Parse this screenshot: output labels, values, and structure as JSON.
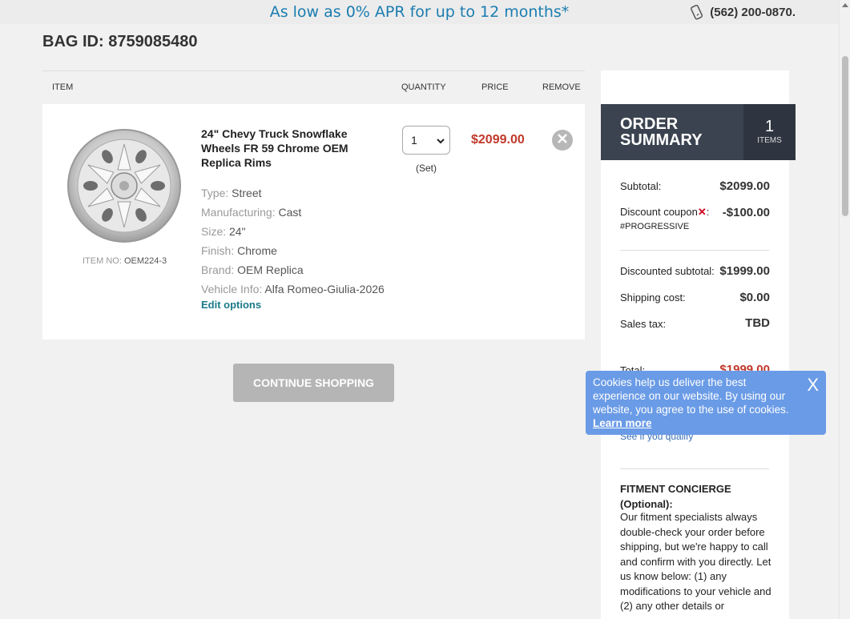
{
  "promo_text": "As low as 0% APR for up to 12 months*",
  "phone": "(562) 200-0870.",
  "bag_id": "BAG ID: 8759085480",
  "cart_headers": {
    "item": "ITEM",
    "quantity": "QUANTITY",
    "price": "PRICE",
    "remove": "REMOVE"
  },
  "item": {
    "title": "24\" Chevy Truck Snowflake Wheels FR 59 Chrome OEM Replica Rims",
    "item_no_label": "ITEM NO:",
    "item_no": "OEM224-3",
    "attributes": [
      {
        "key": "Type:",
        "value": "Street"
      },
      {
        "key": "Manufacturing:",
        "value": "Cast"
      },
      {
        "key": "Size:",
        "value": "24\""
      },
      {
        "key": "Finish:",
        "value": "Chrome"
      },
      {
        "key": "Brand:",
        "value": "OEM Replica"
      },
      {
        "key": "Vehicle Info:",
        "value": "Alfa Romeo-Giulia-2026"
      }
    ],
    "edit_options": "Edit options",
    "quantity": "1",
    "quantity_unit": "(Set)",
    "price": "$2099.00"
  },
  "continue_shopping": "CONTINUE SHOPPING",
  "summary": {
    "title": "ORDER SUMMARY",
    "count": "1",
    "count_label": "ITEMS",
    "subtotal_label": "Subtotal:",
    "subtotal": "$2099.00",
    "discount_label": "Discount coupon",
    "discount_colon": ":",
    "discount": "-$100.00",
    "coupon_code": "#PROGRESSIVE",
    "discounted_label": "Discounted subtotal:",
    "discounted": "$1999.00",
    "shipping_label": "Shipping cost:",
    "shipping": "$0.00",
    "tax_label": "Sales tax:",
    "tax": "TBD",
    "total_label": "Total:",
    "total": "$1999.00",
    "qualify": "See if you qualify",
    "concierge_title": "FITMENT CONCIERGE (Optional):",
    "concierge_text": "Our fitment specialists always double-check your order before shipping, but we're happy to call and confirm with you directly. Let us know below: (1) any modifications to your vehicle and (2) any other details or"
  },
  "cookie": {
    "text": "Cookies help us deliver the best experience on our website. By using our website, you agree to the use of cookies.",
    "learn_more": "Learn more",
    "close": "X"
  },
  "colors": {
    "accent": "#1b7db0",
    "price": "#c0392b",
    "summary_bg": "#3b4350",
    "cookie_bg": "#6a9be6"
  }
}
